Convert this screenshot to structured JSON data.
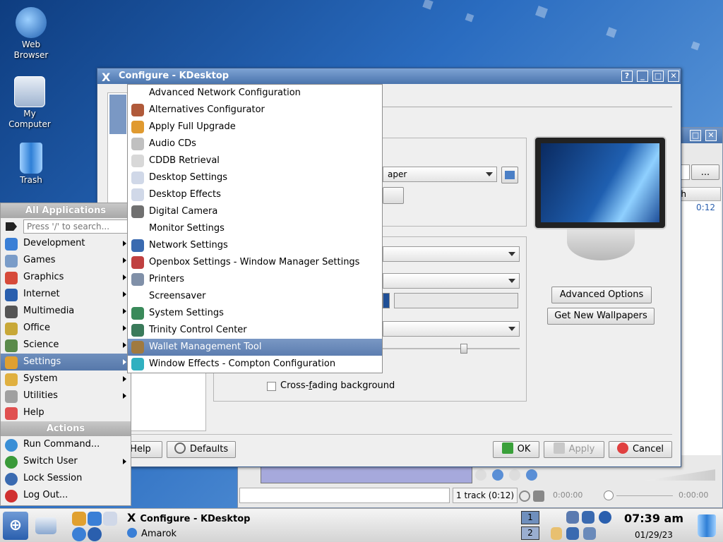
{
  "desktop": {
    "icons": [
      {
        "label_line1": "Web",
        "label_line2": "Browser",
        "icon": "web-browser-icon",
        "color": "#3a7fd6"
      },
      {
        "label_line1": "My",
        "label_line2": "Computer",
        "icon": "computer-icon",
        "color": "#8aa8d0"
      },
      {
        "label_line1": "Trash",
        "label_line2": "",
        "icon": "trash-icon",
        "color": "#5aa0e8"
      }
    ]
  },
  "amarok": {
    "combo_text": "...",
    "header_col": "gth",
    "time_value": "0:12",
    "status_tracks": "1 track (0:12)",
    "time_left": "0:00:00",
    "time_right": "0:00:00"
  },
  "dialog": {
    "title": "Configure - KDesktop",
    "help_btn": "?",
    "wallpaper_combo": "aper",
    "crossfade_label_pre": "Cross-",
    "crossfade_label_ul": "f",
    "crossfade_label_post": "ading background",
    "advanced_options": "Advanced Options",
    "advanced_ul": "v",
    "get_new_wallpapers": "Get New Wallpapers",
    "get_new_ul": "G",
    "btn_help": "Help",
    "btn_defaults": "Defaults",
    "btn_ok": "OK",
    "btn_apply": "Apply",
    "btn_cancel": "Cancel"
  },
  "kmenu": {
    "header_all": "All Applications",
    "search_placeholder": "Press '/' to search...",
    "categories": [
      {
        "label": "Development",
        "icon": "development-icon",
        "color": "#3a7fd6"
      },
      {
        "label": "Games",
        "icon": "games-icon",
        "color": "#7a9cc8"
      },
      {
        "label": "Graphics",
        "icon": "graphics-icon",
        "color": "#d64a3a"
      },
      {
        "label": "Internet",
        "icon": "internet-icon",
        "color": "#2a5fae"
      },
      {
        "label": "Multimedia",
        "icon": "multimedia-icon",
        "color": "#555555"
      },
      {
        "label": "Office",
        "icon": "office-icon",
        "color": "#c8a838"
      },
      {
        "label": "Science",
        "icon": "science-icon",
        "color": "#5a8a4a"
      },
      {
        "label": "Settings",
        "icon": "settings-icon",
        "color": "#e0a030"
      },
      {
        "label": "System",
        "icon": "system-icon",
        "color": "#e0b040"
      },
      {
        "label": "Utilities",
        "icon": "utilities-icon",
        "color": "#a0a0a0"
      },
      {
        "label": "Help",
        "icon": "help-icon",
        "color": "#e05050"
      }
    ],
    "header_actions": "Actions",
    "actions": [
      {
        "label": "Run Command...",
        "icon": "run-command-icon",
        "color": "#3a8fd6"
      },
      {
        "label": "Switch User",
        "icon": "switch-user-icon",
        "color": "#3a9a3a"
      },
      {
        "label": "Lock Session",
        "icon": "lock-icon",
        "color": "#3a6ab0"
      },
      {
        "label": "Log Out...",
        "icon": "logout-icon",
        "color": "#d03030"
      }
    ]
  },
  "submenu": {
    "items": [
      {
        "label": "Advanced Network Configuration",
        "icon": "",
        "color": "#ffffff"
      },
      {
        "label": "Alternatives Configurator",
        "icon": "alternatives-icon",
        "color": "#b05a3a"
      },
      {
        "label": "Apply Full Upgrade",
        "icon": "upgrade-icon",
        "color": "#e09a30"
      },
      {
        "label": "Audio CDs",
        "icon": "audio-cd-icon",
        "color": "#c0c0c0"
      },
      {
        "label": "CDDB Retrieval",
        "icon": "cddb-icon",
        "color": "#d8d8d8"
      },
      {
        "label": "Desktop Settings",
        "icon": "desktop-settings-icon",
        "color": "#d0d8e8"
      },
      {
        "label": "Desktop Effects",
        "icon": "desktop-effects-icon",
        "color": "#d0d8e8"
      },
      {
        "label": "Digital Camera",
        "icon": "camera-icon",
        "color": "#707070"
      },
      {
        "label": "Monitor Settings",
        "icon": "",
        "color": "#ffffff"
      },
      {
        "label": "Network Settings",
        "icon": "network-icon",
        "color": "#3a6ab0"
      },
      {
        "label": "Openbox Settings - Window Manager Settings",
        "icon": "openbox-icon",
        "color": "#c04040"
      },
      {
        "label": "Printers",
        "icon": "printer-icon",
        "color": "#8090a8"
      },
      {
        "label": "Screensaver",
        "icon": "",
        "color": "#ffffff"
      },
      {
        "label": "System Settings",
        "icon": "system-settings-icon",
        "color": "#3a8a5a"
      },
      {
        "label": "Trinity Control Center",
        "icon": "control-center-icon",
        "color": "#3a7a5a"
      },
      {
        "label": "Wallet Management Tool",
        "icon": "wallet-icon",
        "color": "#a07a40"
      },
      {
        "label": "Window Effects - Compton Configuration",
        "icon": "compton-icon",
        "color": "#30b0c0"
      }
    ],
    "selected_index": 15
  },
  "taskbar": {
    "task1": "Configure - KDesktop",
    "task2": "Amarok",
    "pager1": "1",
    "pager2": "2",
    "clock_time": "07:39 am",
    "clock_date": "01/29/23"
  }
}
